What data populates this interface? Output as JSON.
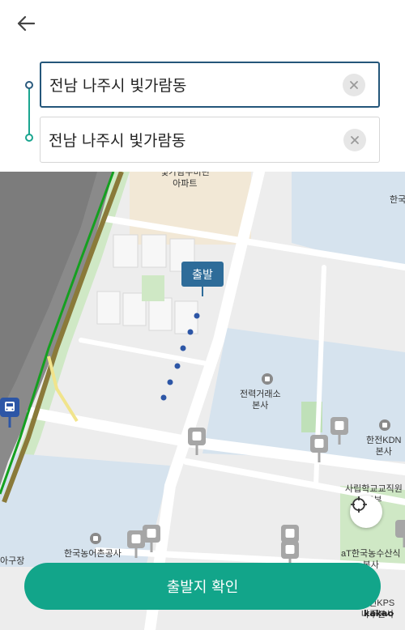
{
  "header": {
    "origin_value": "전남 나주시 빛가람동",
    "destination_value": "전남 나주시 빛가람동"
  },
  "map": {
    "labels": {
      "apartment": "빛가람우미린\n아파트",
      "han1": "한국",
      "kepco": "전력거래소\n본사",
      "kdn": "한전KDN\n본사",
      "school": "사립학교교직원\n본부",
      "krc": "한국농어촌공사",
      "at": "aT한국농수산식\n본사",
      "kps": "한전KPS\n나주본사",
      "park": "아구장"
    },
    "start_marker_label": "출발",
    "colors": {
      "route_dots": "#2d56a6",
      "start_tag": "#2e6c99",
      "road_green": "#15a020",
      "confirm_button": "#12a58a"
    }
  },
  "footer": {
    "confirm_label": "출발지 확인",
    "provider_logo": "kakao"
  }
}
